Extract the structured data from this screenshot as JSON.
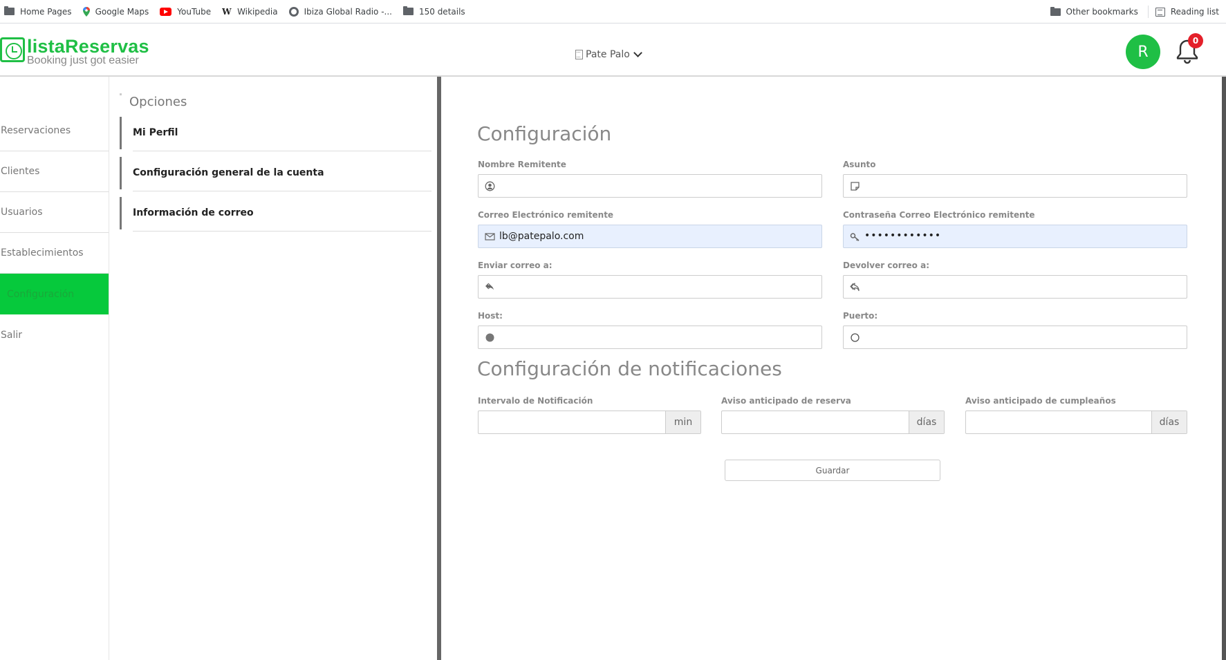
{
  "bookmarks": {
    "items": [
      {
        "label": "Home Pages",
        "icon": "folder-icon"
      },
      {
        "label": "Google Maps",
        "icon": "maps-icon"
      },
      {
        "label": "YouTube",
        "icon": "youtube-icon"
      },
      {
        "label": "Wikipedia",
        "icon": "wikipedia-icon"
      },
      {
        "label": "Ibiza Global Radio -...",
        "icon": "globe-icon"
      },
      {
        "label": "150 details",
        "icon": "folder-icon"
      }
    ],
    "other": "Other bookmarks",
    "reading_list": "Reading list"
  },
  "header": {
    "logo_title": "listaReservas",
    "logo_subtitle": "Booking just got easier",
    "establishment": "Pate Palo",
    "avatar_initial": "R",
    "notification_count": "0",
    "brand_color": "#1fbf45",
    "badge_color": "#e4202a"
  },
  "sidebar": {
    "items": [
      {
        "label": "Reservaciones"
      },
      {
        "label": "Clientes"
      },
      {
        "label": "Usuarios"
      },
      {
        "label": "Establecimientos"
      },
      {
        "label": "Configuración",
        "active": true
      },
      {
        "label": "Salir"
      }
    ],
    "active_color": "#06c93c"
  },
  "options": {
    "title": "Opciones",
    "items": [
      {
        "label": "Mi Perfil"
      },
      {
        "label": "Configuración general de la cuenta"
      },
      {
        "label": "Información de correo"
      }
    ]
  },
  "config": {
    "title": "Configuración",
    "sender_name": {
      "label": "Nombre Remitente",
      "value": "",
      "icon": "user-circle-icon"
    },
    "subject": {
      "label": "Asunto",
      "value": "",
      "icon": "note-icon"
    },
    "sender_email": {
      "label": "Correo Electrónico remitente",
      "value": "lb@patepalo.com",
      "icon": "envelope-icon"
    },
    "sender_password": {
      "label": "Contraseña Correo Electrónico remitente",
      "value": "••••••••••••",
      "icon": "key-icon"
    },
    "send_to": {
      "label": "Enviar correo a:",
      "value": "",
      "icon": "forward-icon"
    },
    "reply_to": {
      "label": "Devolver correo a:",
      "value": "",
      "icon": "reply-icon"
    },
    "host": {
      "label": "Host:",
      "value": "",
      "icon": "filled-circle-icon"
    },
    "port": {
      "label": "Puerto:",
      "value": "",
      "icon": "empty-circle-icon"
    }
  },
  "notifications": {
    "title": "Configuración de notificaciones",
    "interval": {
      "label": "Intervalo de Notificación",
      "value": "",
      "unit": "min"
    },
    "booking_notice": {
      "label": "Aviso anticipado de reserva",
      "value": "",
      "unit": "días"
    },
    "birthday_notice": {
      "label": "Aviso anticipado de cumpleaños",
      "value": "",
      "unit": "días"
    }
  },
  "save_label": "Guardar"
}
